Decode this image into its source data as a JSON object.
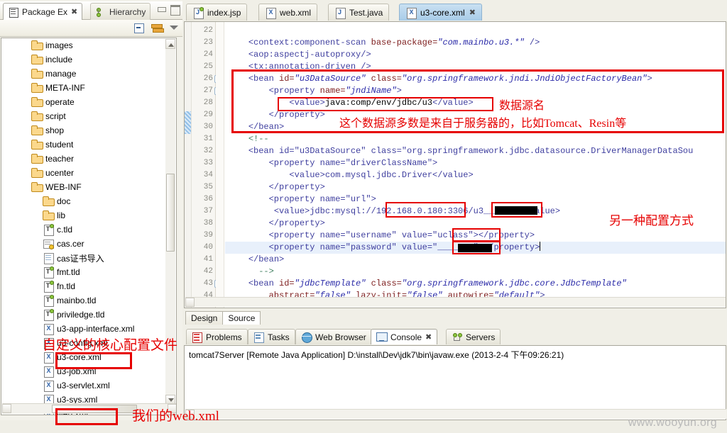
{
  "left_panel": {
    "tabs": [
      {
        "label": "Package Ex",
        "icon": "package-explorer-icon",
        "active": true,
        "close_glyph": "✖"
      },
      {
        "label": "Hierarchy",
        "icon": "hierarchy-icon",
        "active": false
      }
    ],
    "window_buttons": [
      "minimize",
      "maximize"
    ],
    "toolbar_icons": [
      "collapse-all-icon",
      "link-with-editor-icon",
      "view-menu-icon"
    ],
    "tree": [
      {
        "label": "images",
        "icon": "folder-icon",
        "indent": 1,
        "type": "folder"
      },
      {
        "label": "include",
        "icon": "folder-icon",
        "indent": 1,
        "type": "folder"
      },
      {
        "label": "manage",
        "icon": "folder-icon",
        "indent": 1,
        "type": "folder"
      },
      {
        "label": "META-INF",
        "icon": "folder-icon",
        "indent": 1,
        "type": "folder"
      },
      {
        "label": "operate",
        "icon": "folder-icon",
        "indent": 1,
        "type": "folder"
      },
      {
        "label": "script",
        "icon": "folder-icon",
        "indent": 1,
        "type": "folder"
      },
      {
        "label": "shop",
        "icon": "folder-icon",
        "indent": 1,
        "type": "folder"
      },
      {
        "label": "student",
        "icon": "folder-icon",
        "indent": 1,
        "type": "folder"
      },
      {
        "label": "teacher",
        "icon": "folder-icon",
        "indent": 1,
        "type": "folder"
      },
      {
        "label": "ucenter",
        "icon": "folder-icon",
        "indent": 1,
        "type": "folder"
      },
      {
        "label": "WEB-INF",
        "icon": "folder-icon",
        "indent": 1,
        "type": "folder"
      },
      {
        "label": "doc",
        "icon": "folder-icon",
        "indent": 2,
        "type": "folder"
      },
      {
        "label": "lib",
        "icon": "folder-icon",
        "indent": 2,
        "type": "folder"
      },
      {
        "label": "c.tld",
        "icon": "tld-file-icon",
        "indent": 2,
        "type": "tld"
      },
      {
        "label": "cas.cer",
        "icon": "certificate-file-icon",
        "indent": 2,
        "type": "cer"
      },
      {
        "label": "cas证书导入",
        "icon": "document-file-icon",
        "indent": 2,
        "type": "doc"
      },
      {
        "label": "fmt.tld",
        "icon": "tld-file-icon",
        "indent": 2,
        "type": "tld"
      },
      {
        "label": "fn.tld",
        "icon": "tld-file-icon",
        "indent": 2,
        "type": "tld"
      },
      {
        "label": "mainbo.tld",
        "icon": "tld-file-icon",
        "indent": 2,
        "type": "tld"
      },
      {
        "label": "priviledge.tld",
        "icon": "tld-file-icon",
        "indent": 2,
        "type": "tld"
      },
      {
        "label": "u3-app-interface.xml",
        "icon": "xml-file-icon",
        "indent": 2,
        "type": "xml"
      },
      {
        "label": "u3-config.xml",
        "icon": "xml-file-icon",
        "indent": 2,
        "type": "xml"
      },
      {
        "label": "u3-core.xml",
        "icon": "xml-file-icon",
        "indent": 2,
        "type": "xml",
        "highlighted": true
      },
      {
        "label": "u3-job.xml",
        "icon": "xml-file-icon",
        "indent": 2,
        "type": "xml"
      },
      {
        "label": "u3-servlet.xml",
        "icon": "xml-file-icon",
        "indent": 2,
        "type": "xml"
      },
      {
        "label": "u3-sys.xml",
        "icon": "xml-file-icon",
        "indent": 2,
        "type": "xml"
      },
      {
        "label": "web.xml",
        "icon": "xml-file-icon",
        "indent": 2,
        "type": "xml",
        "highlighted": true
      }
    ]
  },
  "editor": {
    "tabs": [
      {
        "label": "index.jsp",
        "icon": "jsp-file-icon",
        "active": false
      },
      {
        "label": "web.xml",
        "icon": "xml-file-icon",
        "active": false
      },
      {
        "label": "Test.java",
        "icon": "java-file-icon",
        "active": false
      },
      {
        "label": "u3-core.xml",
        "icon": "xml-file-icon",
        "active": true,
        "close_glyph": "✖"
      }
    ],
    "first_line_number": 22,
    "last_line_number": 44,
    "fold_lines": [
      26,
      27,
      43
    ],
    "highlighted_line": 40,
    "marker_lines": [
      29,
      30
    ],
    "lines": [
      {
        "n": 22,
        "html": ""
      },
      {
        "n": 23,
        "html": "    <span class='tag'>&lt;context:component-scan</span> <span class='attr'>base-package=</span><span class='val'>\"com.mainbo.u3.*\"</span> <span class='tag'>/&gt;</span>"
      },
      {
        "n": 24,
        "html": "    <span class='tag'>&lt;aop:aspectj-autoproxy/&gt;</span>"
      },
      {
        "n": 25,
        "html": "    <span class='tag'>&lt;tx:annotation-driven /&gt;</span>"
      },
      {
        "n": 26,
        "html": "    <span class='tag'>&lt;bean</span> <span class='attr'>id=</span><span class='val'>\"u3DataSource\"</span> <span class='attr'>class=</span><span class='val'>\"org.springframework.jndi.JndiObjectFactoryBean\"</span><span class='tag'>&gt;</span>"
      },
      {
        "n": 27,
        "html": "        <span class='tag'>&lt;property</span> <span class='attr'>name=</span><span class='val'>\"jndiName\"</span><span class='tag'>&gt;</span>"
      },
      {
        "n": 28,
        "html": "            <span class='tag'>&lt;value&gt;</span><span class='txt'>java:comp/env/jdbc/u3</span><span class='tag'>&lt;/value&gt;</span>"
      },
      {
        "n": 29,
        "html": "        <span class='tag'>&lt;/property&gt;</span>"
      },
      {
        "n": 30,
        "html": "    <span class='tag'>&lt;/bean&gt;</span>"
      },
      {
        "n": 31,
        "html": "    <span class='cmt'>&lt;!--</span>"
      },
      {
        "n": 32,
        "html": "    <span class='cmtsrc'>&lt;bean id=\"u3DataSource\" class=\"org.springframework.jdbc.datasource.DriverManagerDataSou</span>"
      },
      {
        "n": 33,
        "html": "        <span class='cmtsrc'>&lt;property name=\"driverClassName\"&gt;</span>"
      },
      {
        "n": 34,
        "html": "            <span class='cmtsrc'>&lt;value&gt;com.mysql.jdbc.Driver&lt;/value&gt;</span>"
      },
      {
        "n": 35,
        "html": "        <span class='cmtsrc'>&lt;/property&gt;</span>"
      },
      {
        "n": 36,
        "html": "        <span class='cmtsrc'>&lt;property name=\"url\"&gt;</span>"
      },
      {
        "n": 37,
        "html": "         <span class='cmtsrc'>&lt;value&gt;jdbc:mysql://192.168.0.180:3306/u3_______&lt;/value&gt;</span>"
      },
      {
        "n": 38,
        "html": "        <span class='cmtsrc'>&lt;/property&gt;</span>"
      },
      {
        "n": 39,
        "html": "        <span class='cmtsrc'>&lt;property name=\"username\" value=\"uclass\"&gt;&lt;/property&gt;</span>"
      },
      {
        "n": 40,
        "html": "        <span class='cmtsrc'>&lt;property name=\"password\" value=\"_______\"&gt;&lt;/property&gt;</span><span class='caret'></span>"
      },
      {
        "n": 41,
        "html": "    <span class='cmtsrc'>&lt;/bean&gt;</span>"
      },
      {
        "n": 42,
        "html": "      <span class='cmt'>--&gt;</span>"
      },
      {
        "n": 43,
        "html": "    <span class='tag'>&lt;bean</span> <span class='attr'>id=</span><span class='val'>\"jdbcTemplate\"</span> <span class='attr'>class=</span><span class='val'>\"org.springframework.jdbc.core.JdbcTemplate\"</span>"
      },
      {
        "n": 44,
        "html": "        <span class='attr'>abstract=</span><span class='val'>\"false\"</span> <span class='attr'>lazy-init=</span><span class='val'>\"false\"</span> <span class='attr'>autowire=</span><span class='val'>\"default\"</span><span class='tag'>&gt;</span>"
      }
    ],
    "design_source_tabs": [
      {
        "label": "Design",
        "active": false
      },
      {
        "label": "Source",
        "active": true
      }
    ]
  },
  "bottom_view": {
    "tabs": [
      {
        "label": "Problems",
        "icon": "problems-icon",
        "active": false
      },
      {
        "label": "Tasks",
        "icon": "tasks-icon",
        "active": false
      },
      {
        "label": "Web Browser",
        "icon": "web-browser-icon",
        "active": false
      },
      {
        "label": "Console",
        "icon": "console-icon",
        "active": true,
        "close_glyph": "✖"
      },
      {
        "label": "Servers",
        "icon": "servers-icon",
        "active": false
      }
    ],
    "console_line": "tomcat7Server [Remote Java Application] D:\\install\\Dev\\jdk7\\bin\\javaw.exe (2013-2-4 下午09:26:21)"
  },
  "annotations": {
    "datasource_name": "数据源名",
    "server_note": "这个数据源多数是来自于服务器的，比如Tomcat、Resin等",
    "another_config": "另一种配置方式",
    "core_config_file": "自定义的核心配置文件",
    "our_web_xml": "我们的web.xml",
    "color": "#e60000"
  },
  "watermark": "www.wooyun.org"
}
